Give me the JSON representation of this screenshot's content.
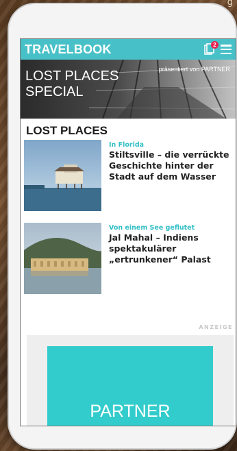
{
  "background": {
    "top_right_text": "g"
  },
  "app_bar": {
    "brand": "TRAVELBOOK",
    "bookmark_count": "2",
    "accent_color": "#47c1c7"
  },
  "hero": {
    "title_line1": "LOST PLACES",
    "title_line2": "SPECIAL",
    "sponsor": "präsentiert von PARTNER"
  },
  "section": {
    "title": "LOST PLACES"
  },
  "articles": [
    {
      "kicker": "In Florida",
      "headline": "Stiltsville – die verrückte Geschichte hinter der Stadt auf dem Wasser"
    },
    {
      "kicker": "Von einem See geflutet",
      "headline": "Jal Mahal – Indiens spektakulärer „ertrunkener“ Palast"
    }
  ],
  "ad": {
    "tag": "ANZEIGE",
    "label": "PARTNER",
    "color": "#33cccc"
  }
}
